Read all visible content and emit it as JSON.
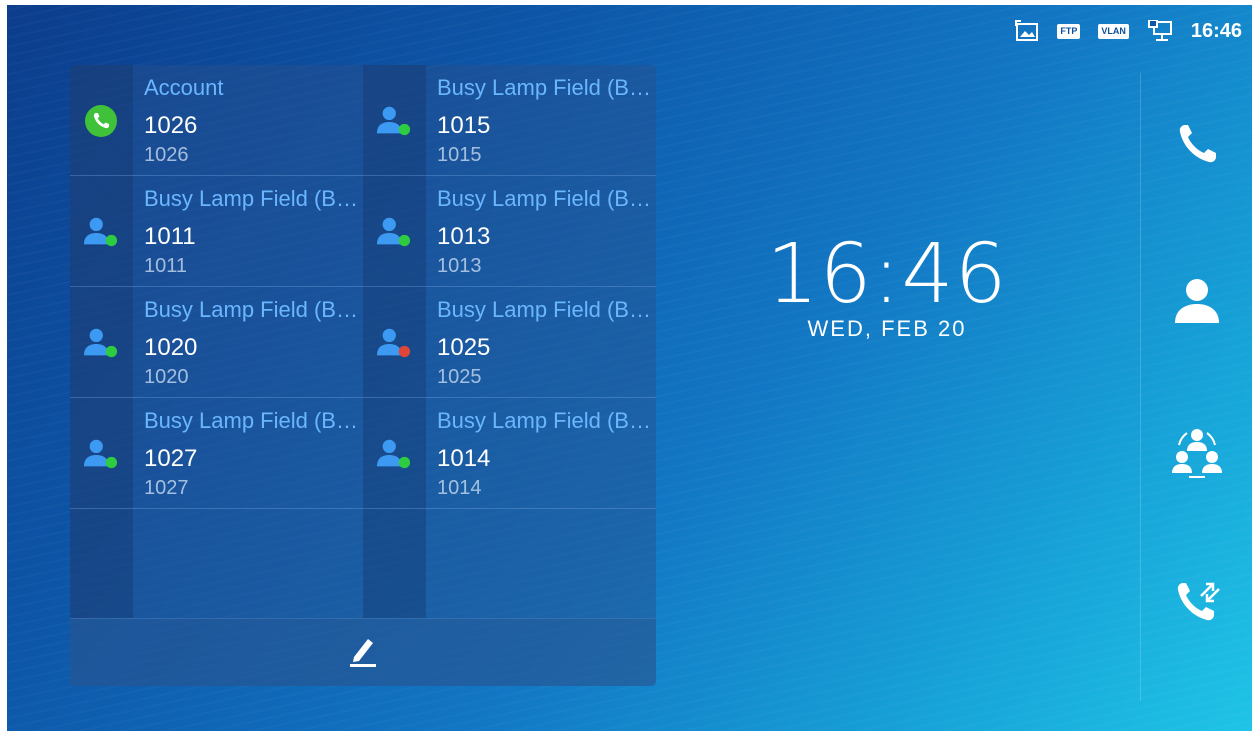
{
  "status_bar": {
    "icons": [
      "screenshot-icon",
      "ftp-icon",
      "vlan-icon",
      "network-icon"
    ],
    "ftp_label": "FTP",
    "vlan_label": "VLAN",
    "time": "16:46"
  },
  "panel": {
    "tiles": [
      {
        "title": "Account",
        "extension": "1026",
        "number": "1026",
        "icon": "phone-icon",
        "status_color": "#2ecc40"
      },
      {
        "title": "Busy Lamp Field (B…",
        "extension": "1015",
        "number": "1015",
        "icon": "contact-icon",
        "status_color": "#2ecc40"
      },
      {
        "title": "Busy Lamp Field (B…",
        "extension": "1011",
        "number": "1011",
        "icon": "contact-icon",
        "status_color": "#2ecc40"
      },
      {
        "title": "Busy Lamp Field (B…",
        "extension": "1013",
        "number": "1013",
        "icon": "contact-icon",
        "status_color": "#2ecc40"
      },
      {
        "title": "Busy Lamp Field (B…",
        "extension": "1020",
        "number": "1020",
        "icon": "contact-icon",
        "status_color": "#2ecc40"
      },
      {
        "title": "Busy Lamp Field (B…",
        "extension": "1025",
        "number": "1025",
        "icon": "contact-icon",
        "status_color": "#e0453a"
      },
      {
        "title": "Busy Lamp Field (B…",
        "extension": "1027",
        "number": "1027",
        "icon": "contact-icon",
        "status_color": "#2ecc40"
      },
      {
        "title": "Busy Lamp Field (B…",
        "extension": "1014",
        "number": "1014",
        "icon": "contact-icon",
        "status_color": "#2ecc40"
      }
    ],
    "edit_icon": "pencil-icon"
  },
  "clock": {
    "time": "16:46",
    "date": "WED, FEB 20"
  },
  "dock": {
    "buttons": [
      "phone-icon",
      "contacts-icon",
      "conference-icon",
      "call-transfer-icon"
    ]
  },
  "colors": {
    "title_blue": "#6ab6ff",
    "available_green": "#2ecc40",
    "busy_red": "#e0453a",
    "account_green": "#3fc23a"
  }
}
